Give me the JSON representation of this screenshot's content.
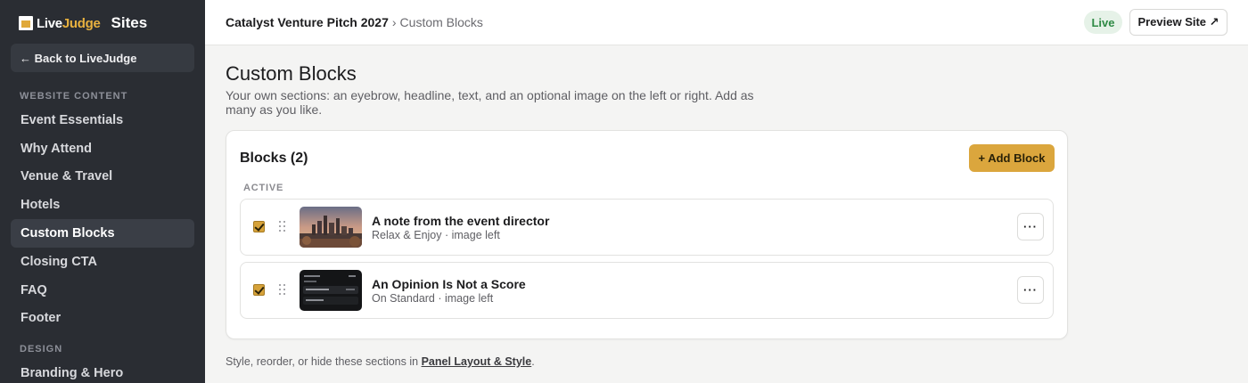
{
  "sidebar": {
    "logo": {
      "live": "Live",
      "judge": "Judge"
    },
    "title": "Sites",
    "back_label": "← Back to LiveJudge",
    "sections": [
      {
        "label": "WEBSITE CONTENT"
      },
      {
        "label": "DESIGN"
      }
    ],
    "items": [
      {
        "label": "Event Essentials"
      },
      {
        "label": "Why Attend"
      },
      {
        "label": "Venue & Travel"
      },
      {
        "label": "Hotels"
      },
      {
        "label": "Custom Blocks",
        "active": true
      },
      {
        "label": "Closing CTA"
      },
      {
        "label": "FAQ"
      },
      {
        "label": "Footer"
      },
      {
        "label": "Branding & Hero"
      }
    ]
  },
  "header": {
    "event_name": "Catalyst Venture Pitch 2027",
    "separator": "›",
    "current_page": "Custom Blocks",
    "status_badge": "Live",
    "preview_label": "Preview Site ↗"
  },
  "main": {
    "title": "Custom Blocks",
    "description": "Your own sections: an eyebrow, headline, text, and an optional image on the left or right. Add as many as you like.",
    "card": {
      "title": "Blocks (2)",
      "add_label": "+ Add Block",
      "group_label": "ACTIVE",
      "blocks": [
        {
          "title": "A note from the event director",
          "subtitle": "Relax & Enjoy · image left",
          "checked": true,
          "menu_label": "···"
        },
        {
          "title": "An Opinion Is Not a Score",
          "subtitle": "On Standard · image left",
          "checked": true,
          "menu_label": "···"
        }
      ]
    },
    "footnote": {
      "prefix": "Style, reorder, or hide these sections in ",
      "link": "Panel Layout & Style",
      "suffix": "."
    }
  },
  "colors": {
    "sidebar_bg": "#2a2d33",
    "accent": "#dba63d",
    "live_green": "#2f8a45"
  }
}
